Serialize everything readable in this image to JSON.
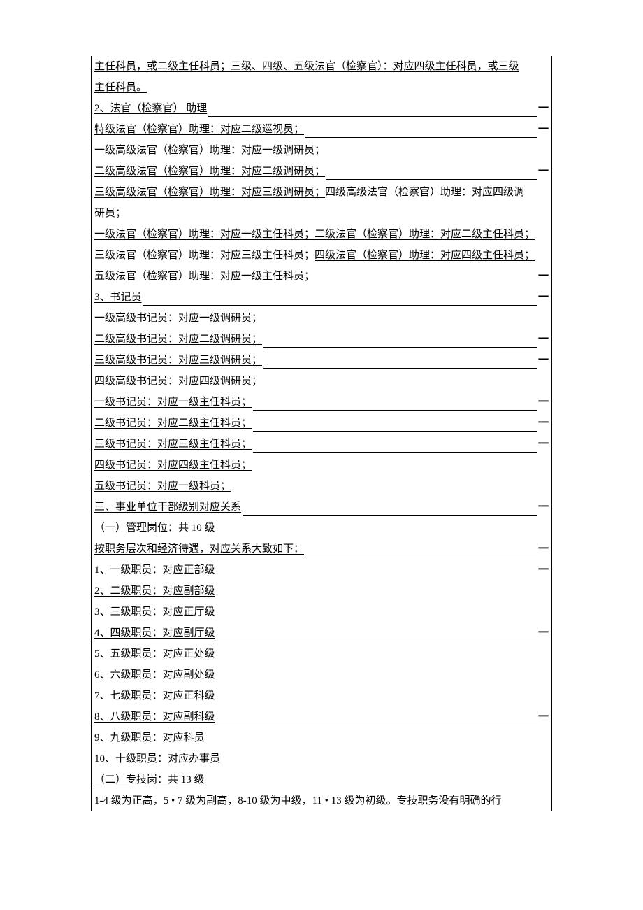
{
  "lines": [
    {
      "type": "plain",
      "text": "主任科员，或二级主任科员；三级、四级、五级法官（检察官）：对应四级主任科员，或三级",
      "underline": true
    },
    {
      "type": "plain",
      "text": "主任科员。",
      "underline": true
    },
    {
      "type": "dash",
      "prefix": "2、法官（检察官） 助理",
      "underline": true
    },
    {
      "type": "dash",
      "prefix": "特级法官（检察官）助理：对应二级巡视员；",
      "underline": true
    },
    {
      "type": "plain",
      "text": "一级高级法官（检察官）助理：对应一级调研员；",
      "underline": false
    },
    {
      "type": "dash",
      "prefix": "二级高级法官（检察官）助理：对应二级调研员；",
      "underline": true
    },
    {
      "type": "plain",
      "text": "三级高级法官（检察官）助理：对应三级调研员；四级高级法官（检察官）助理：对应四级调",
      "underline_prefix": "三级高级法官（检察官）助理：对应三级调研员；",
      "suffix": "四级高级法官（检察官）助理：对应四级调"
    },
    {
      "type": "plain",
      "text": "研员；",
      "underline": false
    },
    {
      "type": "plain",
      "text": "一级法官（检察官）助理：对应一级主任科员；二级法官（检察官）助理：对应二级主任科员；",
      "underline": true
    },
    {
      "type": "mixed",
      "prefix": "三级法官（检察官）助理：对应三级主任科员；",
      "suffix": "四级法官（检察官）助理：对应四级主任科员；"
    },
    {
      "type": "plain_dash",
      "text": "五级法官（检察官）助理：对应一级主任科员；",
      "underline": false
    },
    {
      "type": "dash",
      "prefix": "3、书记员",
      "underline": true
    },
    {
      "type": "plain",
      "text": "一级高级书记员：对应一级调研员；",
      "underline": false
    },
    {
      "type": "dash",
      "prefix": "二级高级书记员：对应二级调研员；",
      "underline": true
    },
    {
      "type": "dash",
      "prefix": "三级高级书记员：对应三级调研员；",
      "underline": true
    },
    {
      "type": "plain",
      "text": "四级高级书记员：对应四级调研员；",
      "underline": false
    },
    {
      "type": "dash",
      "prefix": "一级书记员：对应一级主任科员；",
      "underline": true
    },
    {
      "type": "dash",
      "prefix": "二级书记员：对应二级主任科员；",
      "underline": true
    },
    {
      "type": "dash",
      "prefix": "三级书记员：对应三级主任科员；",
      "underline": true
    },
    {
      "type": "plain",
      "text": "四级书记员：对应四级主任科员；",
      "underline": true
    },
    {
      "type": "plain",
      "text": "五级书记员：对应一级科员；",
      "underline": true
    },
    {
      "type": "dash",
      "prefix": "三、事业单位干部级别对应关系",
      "underline": true
    },
    {
      "type": "plain",
      "text": "（一）管理岗位：共 10 级",
      "underline": false
    },
    {
      "type": "dash",
      "prefix": "按职务层次和经济待遇，对应关系大致如下：",
      "underline": true
    },
    {
      "type": "plain_dash",
      "text": "1、一级职员：对应正部级",
      "underline": false
    },
    {
      "type": "plain",
      "text": "2、二级职员：对应副部级",
      "underline": true
    },
    {
      "type": "plain",
      "text": "3、三级职员：对应正厅级",
      "underline": false
    },
    {
      "type": "dash",
      "prefix": "4、四级职员：对应副厅级",
      "underline": true
    },
    {
      "type": "plain",
      "text": "5、五级职员：对应正处级",
      "underline": false
    },
    {
      "type": "plain",
      "text": "6、六级职员：对应副处级",
      "underline": false
    },
    {
      "type": "plain",
      "text": "7、七级职员：对应正科级",
      "underline": false
    },
    {
      "type": "dash",
      "prefix": "8、八级职员：对应副科级",
      "underline": true
    },
    {
      "type": "plain",
      "text": "9、九级职员：对应科员",
      "underline": false
    },
    {
      "type": "plain",
      "text": "10、十级职员：对应办事员",
      "underline": false
    },
    {
      "type": "plain",
      "text": "（二）专技岗：共 13 级",
      "underline": true
    },
    {
      "type": "plain",
      "text": "1-4 级为正高，5 • 7 级为副高，8-10 级为中级，11 • 13 级为初级。专技职务没有明确的行",
      "underline": false
    }
  ]
}
